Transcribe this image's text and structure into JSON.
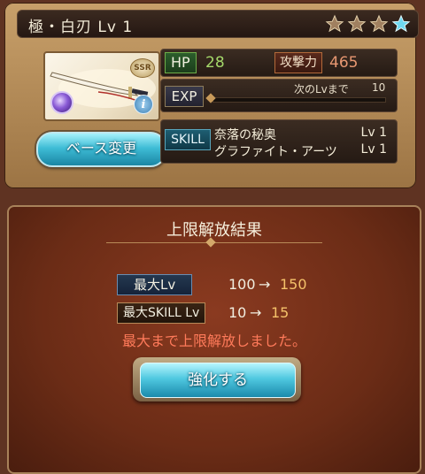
{
  "header": {
    "title": "極・白刃 Lv 1",
    "stars": [
      "filled",
      "filled",
      "filled",
      "uncap"
    ]
  },
  "card": {
    "rarity": "SSR"
  },
  "base_change_label": "ベース変更",
  "stats": {
    "hp_label": "HP",
    "hp_value": "28",
    "atk_label": "攻撃力",
    "atk_value": "465"
  },
  "exp": {
    "label": "EXP",
    "next_label": "次のLvまで",
    "next_value": "10",
    "progress": 0
  },
  "skills": {
    "label": "SKILL",
    "items": [
      {
        "name": "奈落の秘奥",
        "lv": "Lv 1"
      },
      {
        "name": "グラファイト・アーツ",
        "lv": "Lv 1"
      }
    ]
  },
  "result": {
    "title": "上限解放結果",
    "max_lv_label": "最大Lv",
    "max_lv_old": "100",
    "max_lv_arrow": "→",
    "max_lv_new": "150",
    "max_skill_label": "最大SKILL Lv",
    "max_skill_old": "10",
    "max_skill_arrow": "→",
    "max_skill_new": "15",
    "message": "最大まで上限解放しました。",
    "enhance_label": "強化する"
  },
  "colors": {
    "accent_cyan": "#4fc8e0",
    "new_value": "#f5c26a",
    "message_red": "#ff7a5a"
  }
}
